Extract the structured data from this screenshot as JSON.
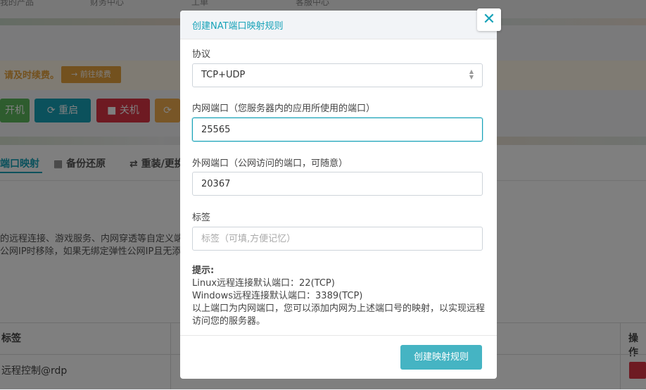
{
  "background": {
    "nav": [
      "我的产品",
      "财务中心",
      "工单",
      "客服中心"
    ],
    "warn_text": "请及时续费。",
    "warn_button": "→ 前往续费",
    "buttons": [
      {
        "label": "开机",
        "color": "#5cb85c"
      },
      {
        "label": "⟳ 重启",
        "color": "#17a2b8"
      },
      {
        "label": "■ 关机",
        "color": "#dc3545"
      },
      {
        "label": "⟳",
        "color": "#f0ad4e"
      }
    ],
    "tabs": [
      "端口映射",
      "备份还原",
      "重装/更换"
    ],
    "desc_line1": "的远程连接、游戏服务、内网穿透等自定义端",
    "desc_line2": "公网IP时移除，如果无绑定弹性公网IP且无添加",
    "table_header_label": "标签",
    "table_header_action": "操作",
    "table_row_label": "远程控制@rdp"
  },
  "modal": {
    "title": "创建NAT端口映射规则",
    "close_symbol": "✕",
    "protocol_label": "协议",
    "protocol_value": "TCP+UDP",
    "internal_label": "内网端口（您服务器内的应用所使用的端口）",
    "internal_value": "25565",
    "external_label": "外网端口（公网访问的端口，可随意）",
    "external_value": "20367",
    "tag_label": "标签",
    "tag_placeholder": "标签（可填,方便记忆）",
    "hint_title": "提示:",
    "hint_lines": [
      "Linux远程连接默认端口：22(TCP)",
      "Windows远程连接默认端口：3389(TCP)",
      "以上端口为内网端口，您可以添加内网为上述端口号的映射，以实现远程访问您的服务器。"
    ],
    "submit_label": "创建映射规则"
  },
  "colors": {
    "accent": "#17a2b8",
    "submit": "#45b4c3"
  }
}
